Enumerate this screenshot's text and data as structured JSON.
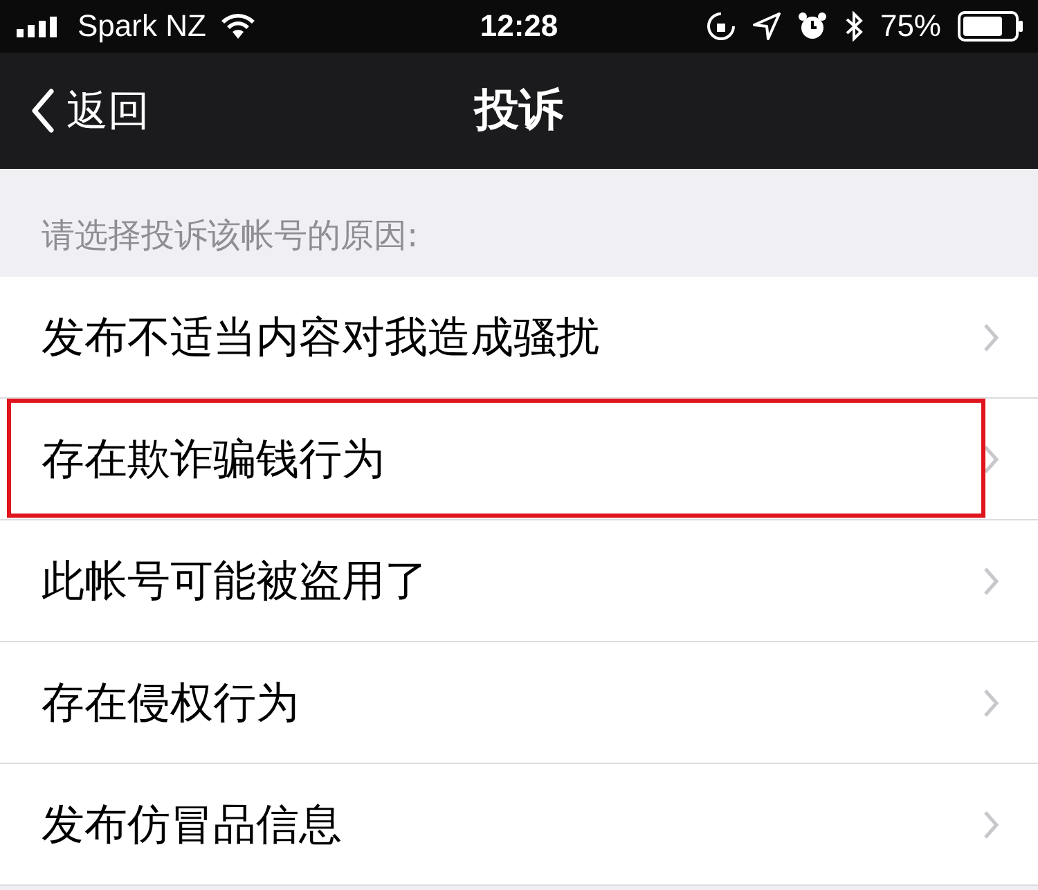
{
  "status_bar": {
    "carrier": "Spark NZ",
    "time": "12:28",
    "battery": "75%"
  },
  "nav_bar": {
    "back": "返回",
    "title": "投诉"
  },
  "section": {
    "header": "请选择投诉该帐号的原因:"
  },
  "items": [
    {
      "label": "发布不适当内容对我造成骚扰",
      "highlighted": false
    },
    {
      "label": "存在欺诈骗钱行为",
      "highlighted": true
    },
    {
      "label": "此帐号可能被盗用了",
      "highlighted": false
    },
    {
      "label": "存在侵权行为",
      "highlighted": false
    },
    {
      "label": "发布仿冒品信息",
      "highlighted": false
    }
  ]
}
